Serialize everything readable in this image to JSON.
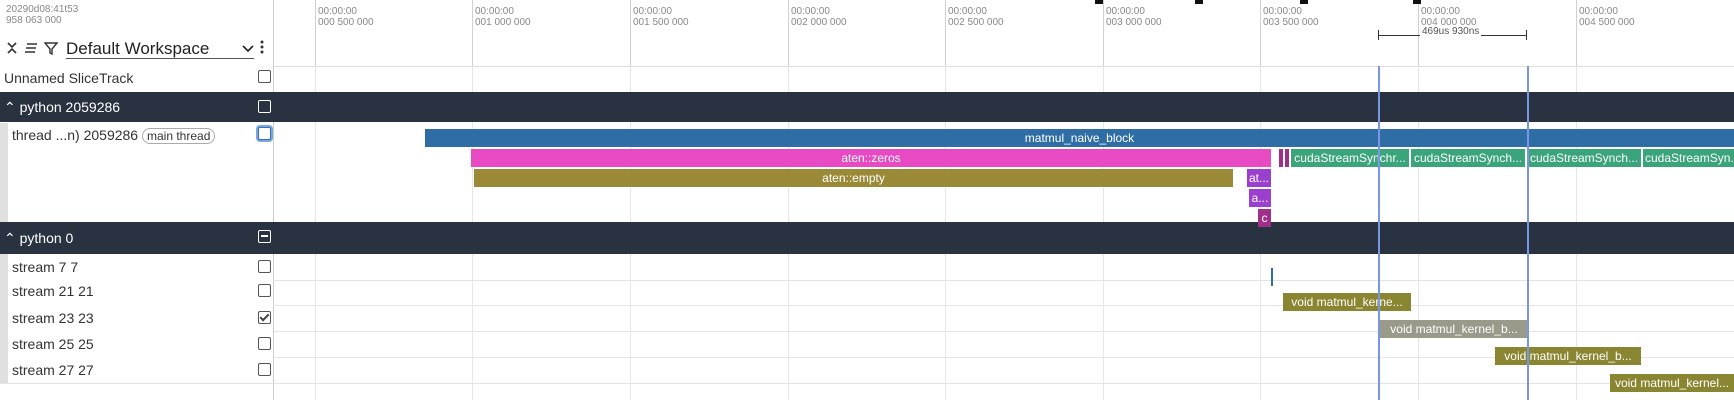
{
  "header": {
    "timestamp_line1": "20290d08:41t53",
    "timestamp_line2": "958 063 000",
    "ticks": [
      {
        "top": "00:00:00",
        "bottom": "000 500 000"
      },
      {
        "top": "00:00:00",
        "bottom": "001 000 000"
      },
      {
        "top": "00:00:00",
        "bottom": "001 500 000"
      },
      {
        "top": "00:00:00",
        "bottom": "002 000 000"
      },
      {
        "top": "00:00:00",
        "bottom": "002 500 000"
      },
      {
        "top": "00:00:00",
        "bottom": "003 000 000"
      },
      {
        "top": "00:00:00",
        "bottom": "003 500 000"
      },
      {
        "top": "00:00:00",
        "bottom": "004 000 000"
      },
      {
        "top": "00:00:00",
        "bottom": "004 500 000"
      }
    ],
    "span_label": "469us 930ns",
    "workspace": "Default Workspace",
    "icons": {
      "collapse": "collapse-all-icon",
      "sort": "sort-icon",
      "filter": "filter-icon",
      "caret": "chevron-down-icon",
      "more": "more-vertical-icon"
    }
  },
  "tracks": {
    "unnamed": "Unnamed SliceTrack",
    "group1": "python 2059286",
    "thread_label": "thread ...n) 2059286",
    "thread_pill": "main thread",
    "group2": "python 0",
    "streams": [
      {
        "label": "stream 7 7",
        "checked": false
      },
      {
        "label": "stream 21 21",
        "checked": false
      },
      {
        "label": "stream 23 23",
        "checked": true
      },
      {
        "label": "stream 25 25",
        "checked": false
      },
      {
        "label": "stream 27 27",
        "checked": false
      }
    ]
  },
  "slices": {
    "matmul": "matmul_naive_block",
    "zeros": "aten::zeros",
    "empty": "aten::empty",
    "at1": "at...",
    "a2": "a...",
    "c3": "c",
    "cuda1": "cudaStreamSynchr...",
    "cuda2": "cudaStreamSynch...",
    "cuda3": "cudaStreamSynch...",
    "cuda4": "cudaStreamSyn...",
    "k21": "void matmul_kerne...",
    "k23": "void matmul_kernel_b...",
    "k25": "void matmul_kernel_b...",
    "k27": "void matmul_kernel..."
  },
  "colors": {
    "group_header": "#283240",
    "matmul": "#2f6ea5",
    "zeros": "#e84ac4",
    "empty": "#9a8a38",
    "purple": "#9b3fcf",
    "cuda": "#3aa47a",
    "kernel": "#8a8530",
    "kernel_selected": "#9a9a8a",
    "cursor": "#7b95e6"
  }
}
